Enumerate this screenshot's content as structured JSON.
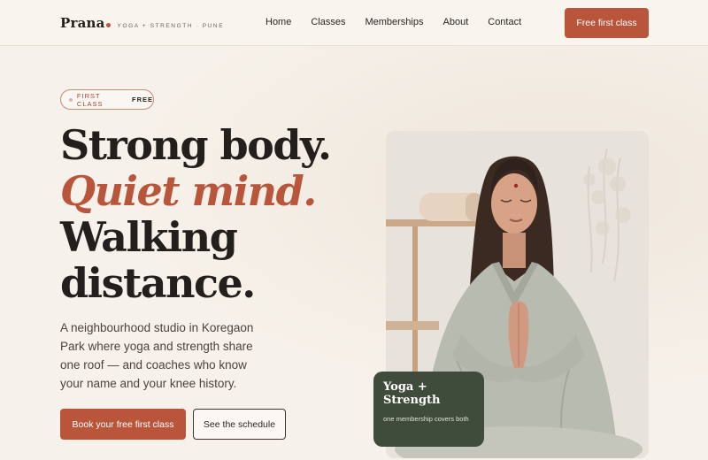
{
  "brand": {
    "name": "Prana",
    "tagline": "YOGA + STRENGTH · PUNE",
    "accent_color": "#b9553a"
  },
  "nav": {
    "items": [
      {
        "label": "Home"
      },
      {
        "label": "Classes"
      },
      {
        "label": "Memberships"
      },
      {
        "label": "About"
      },
      {
        "label": "Contact"
      }
    ],
    "cta_label": "Free first class"
  },
  "hero": {
    "pill_text": "FIRST CLASS",
    "pill_strong": "FREE",
    "headline": {
      "line1": "Strong body.",
      "line2": "Quiet mind.",
      "line3": "Walking",
      "line4": "distance."
    },
    "lede": "A neighbourhood studio in Koregaon Park where yoga and strength share one roof — and coaches who know your name and your knee history.",
    "primary_button": "Book your free first class",
    "secondary_button": "See the schedule"
  },
  "photo_card": {
    "title": "Yoga + Strength",
    "subtitle": "one membership covers both"
  },
  "colors": {
    "background": "#f6f1ea",
    "accent": "#b9553a",
    "card_green": "#3f4b3b"
  }
}
